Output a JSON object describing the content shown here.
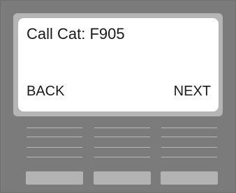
{
  "screen": {
    "line1": "Call Cat: F905",
    "softkeys": {
      "left_label": "BACK",
      "right_label": "NEXT"
    }
  },
  "colors": {
    "device_body": "#7b7b7b",
    "bezel": "#b5b5b5",
    "display_bg": "#ffffff",
    "text": "#1a1a1a",
    "button": "#b3b3b3"
  }
}
